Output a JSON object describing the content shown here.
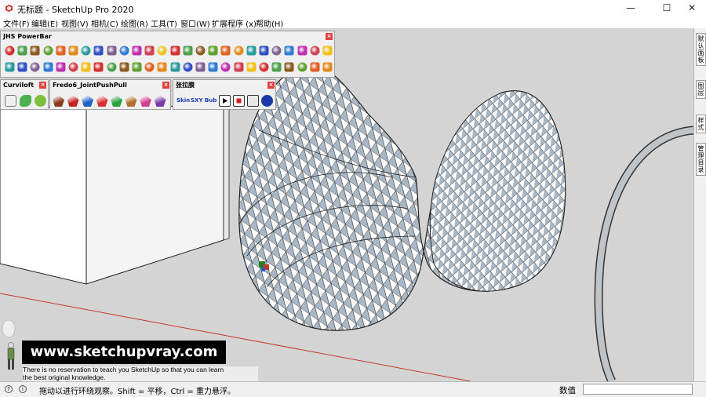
{
  "app": {
    "title": "无标题 - SketchUp Pro 2020",
    "colors": {
      "accent": "#cc2222",
      "toolbar_bg": "#f0f0f0",
      "viewport_bg": "#d4d4d4",
      "surface_front": "#ffffff",
      "surface_back": "#a9b8c6"
    }
  },
  "window_controls": {
    "minimize": "—",
    "maximize": "☐",
    "close": "✕"
  },
  "menu": {
    "items": [
      "文件(F)",
      "编辑(E)",
      "视图(V)",
      "相机(C)",
      "绘图(R)",
      "工具(T)",
      "窗口(W)",
      "扩展程序 (x)",
      "帮助(H)"
    ]
  },
  "toolbars": {
    "jhs": {
      "title": "JHS PowerBar",
      "close": "×"
    },
    "curviloft": {
      "title": "Curviloft",
      "close": "×"
    },
    "fredo": {
      "title": "Fredo6_JointPushPull",
      "close": "×"
    },
    "zhang": {
      "title": "张拉膜",
      "close": "×",
      "tools": [
        "Skin",
        "SXY",
        "Bub"
      ]
    }
  },
  "tray": {
    "tabs": [
      "默认面板",
      "图层",
      "样式",
      "管理目录"
    ]
  },
  "overlay": {
    "banner": "www.sketchupvray.com",
    "caption_line1": "There is no reservation to teach you SketchUp so that you can learn",
    "caption_line2": "the best original knowledge."
  },
  "status": {
    "icon1": "?",
    "icon2": "i",
    "text": "拖动以进行环绕观察。Shift = 平移，Ctrl = 重力悬浮。",
    "measure_label": "数值",
    "measure_value": ""
  }
}
